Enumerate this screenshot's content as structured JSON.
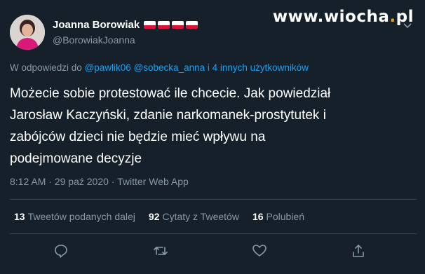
{
  "author": {
    "display_name": "Joanna Borowiak",
    "handle": "@BorowiakJoanna",
    "flag_count": 4
  },
  "watermark": {
    "prefix": "www.",
    "site": "wiocha",
    "dot": ".",
    "tld": "pl"
  },
  "reply": {
    "prefix": "W odpowiedzi do",
    "mention1": "@pawlik06",
    "mention2": "@sobecka_anna",
    "suffix": "i 4 innych użytkowników"
  },
  "tweet_text": {
    "line1": "Możecie sobie protestować ile chcecie. Jak powiedział",
    "line2": "Jarosław Kaczyński, zdanie narkomanek-prostytutek i",
    "line3": "zabójców dzieci nie będzie mieć wpływu na",
    "line4": "podejmowane decyzje"
  },
  "meta": {
    "time": "8:12 AM",
    "sep1": " · ",
    "date": "29 paź 2020",
    "sep2": " · ",
    "source": "Twitter Web App"
  },
  "stats": {
    "retweets_count": "13",
    "retweets_label": "Tweetów podanych dalej",
    "quotes_count": "92",
    "quotes_label": "Cytaty z Tweetów",
    "likes_count": "16",
    "likes_label": "Polubień"
  },
  "actions": [
    "reply-icon",
    "retweet-icon",
    "like-icon",
    "share-icon"
  ],
  "colors": {
    "background": "#15202b",
    "secondary": "#8899a6",
    "accent": "#1da1f2",
    "divider": "#38444d"
  }
}
